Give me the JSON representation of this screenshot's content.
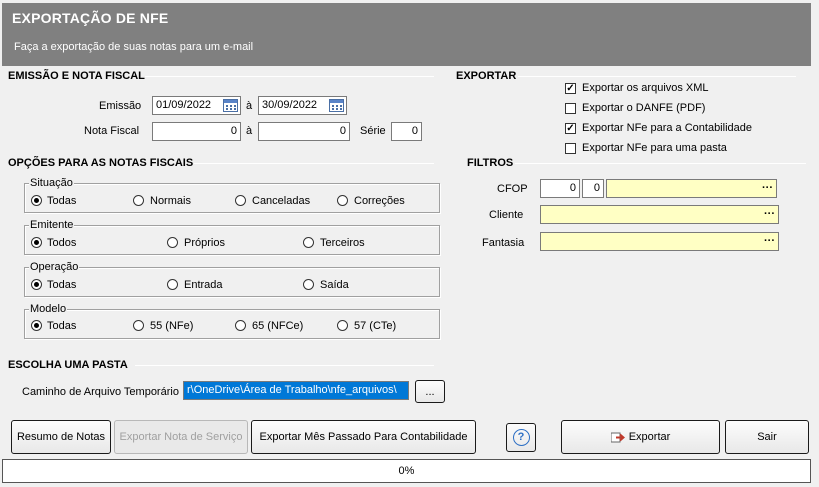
{
  "header": {
    "title": "EXPORTAÇÃO DE NFE",
    "subtitle": "Faça a exportação de suas notas para um e-mail"
  },
  "emissao": {
    "section": "EMISSÃO E NOTA FISCAL",
    "emissao_label": "Emissão",
    "date_from": "01/09/2022",
    "date_to": "30/09/2022",
    "a1": "à",
    "nota_label": "Nota Fiscal",
    "nota_from": "0",
    "nota_to": "0",
    "a2": "à",
    "serie_label": "Série",
    "serie": "0"
  },
  "exportar": {
    "section": "EXPORTAR",
    "options": [
      {
        "label": "Exportar os arquivos XML",
        "checked": true
      },
      {
        "label": "Exportar o DANFE (PDF)",
        "checked": false
      },
      {
        "label": "Exportar NFe para a Contabilidade",
        "checked": true
      },
      {
        "label": "Exportar NFe para uma pasta",
        "checked": false
      }
    ]
  },
  "opcoes": {
    "section": "OPÇÕES PARA AS NOTAS FISCAIS",
    "situacao": {
      "title": "Situação",
      "options": [
        "Todas",
        "Normais",
        "Canceladas",
        "Correções"
      ],
      "selected": "Todas"
    },
    "emitente": {
      "title": "Emitente",
      "options": [
        "Todos",
        "Próprios",
        "Terceiros"
      ],
      "selected": "Todos"
    },
    "operacao": {
      "title": "Operação",
      "options": [
        "Todas",
        "Entrada",
        "Saída"
      ],
      "selected": "Todas"
    },
    "modelo": {
      "title": "Modelo",
      "options": [
        "Todas",
        "55 (NFe)",
        "65 (NFCe)",
        "57 (CTe)"
      ],
      "selected": "Todas"
    }
  },
  "filtros": {
    "section": "FILTROS",
    "cfop_label": "CFOP",
    "cfop_1": "0",
    "cfop_2": "0",
    "cliente_label": "Cliente",
    "fantasia_label": "Fantasia",
    "lookup": "···"
  },
  "pasta": {
    "section": "ESCOLHA UMA PASTA",
    "caminho_label": "Caminho de Arquivo Temporário",
    "caminho_value": "r\\OneDrive\\Área de Trabalho\\nfe_arquivos\\",
    "browse": "..."
  },
  "buttons": {
    "resumo": "Resumo de Notas",
    "exportar_servico": "Exportar Nota de Serviço",
    "exportar_mes": "Exportar Mês Passado Para Contabilidade",
    "help": "?",
    "exportar": "Exportar",
    "sair": "Sair"
  },
  "progress": {
    "value": 0,
    "text": "0%"
  }
}
